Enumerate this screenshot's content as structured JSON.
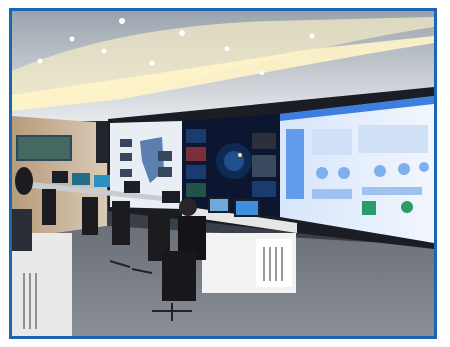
{
  "photo": {
    "subject": "control-room",
    "colors": {
      "frame_border": "#1a66b3",
      "ceiling": "#d9dde2",
      "ceiling_light": "#fff6c9",
      "wall": "#c8b59b",
      "floor": "#707680",
      "video_wall_bg": "#0c1630",
      "dashboard_panel": "#e8f0fb",
      "dashboard_header": "#3d7fe0",
      "desk": "#e6e6e6",
      "chair": "#1c1c20"
    }
  }
}
